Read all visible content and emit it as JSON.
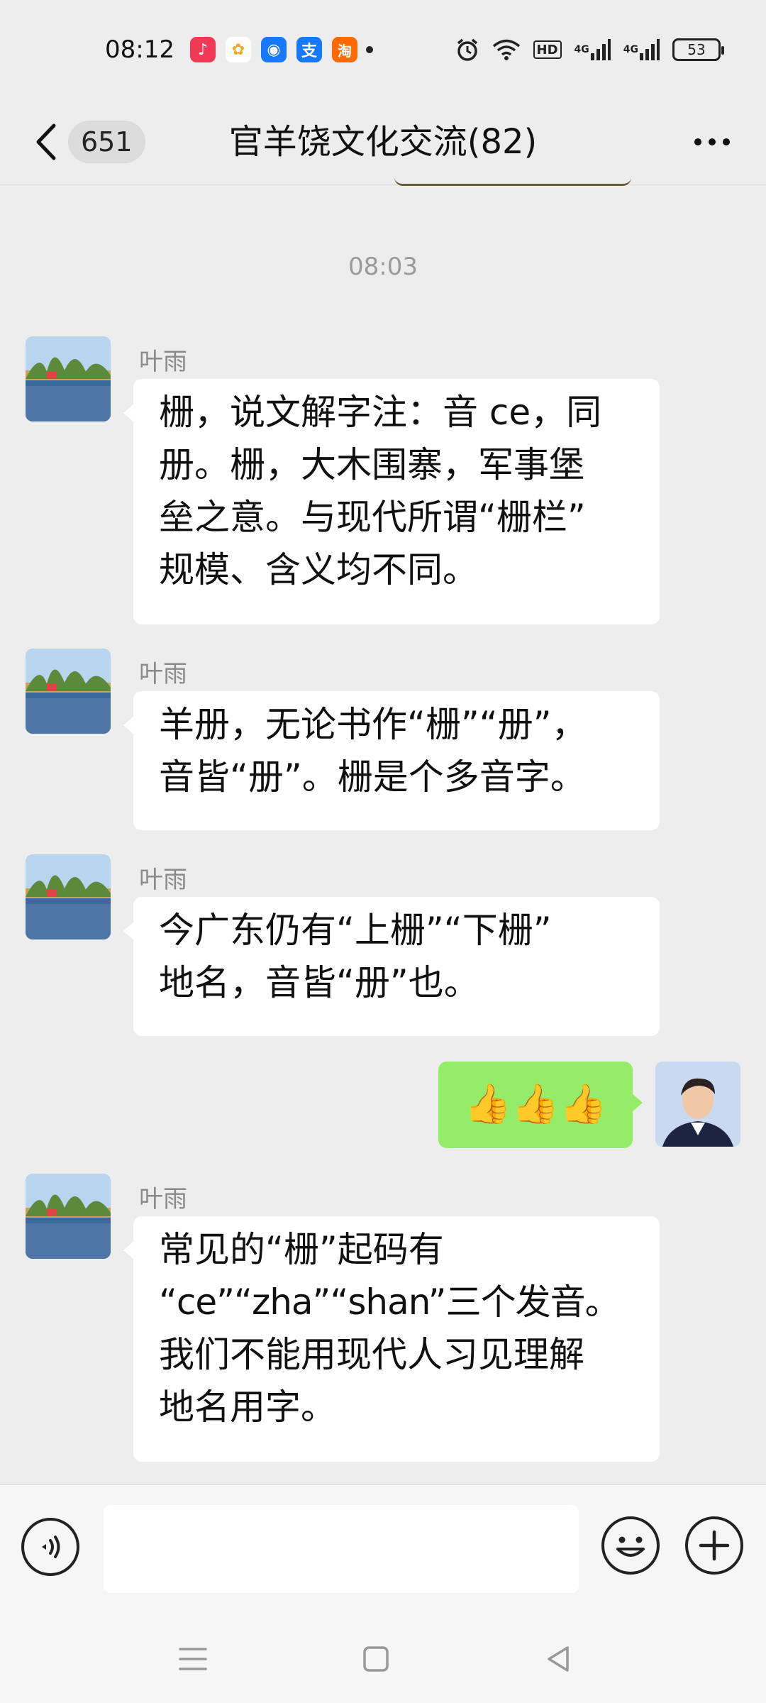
{
  "status_bar": {
    "time": "08:12",
    "app_icons": [
      {
        "name": "music-app-icon",
        "color": "#f03a55",
        "glyph": "♪"
      },
      {
        "name": "pinwheel-app-icon",
        "color": "#3bb3ff",
        "glyph": "✿"
      },
      {
        "name": "browser-app-icon",
        "color": "#1677ff",
        "glyph": "◉"
      },
      {
        "name": "alipay-app-icon",
        "color": "#1677ff",
        "glyph": "支"
      },
      {
        "name": "taobao-app-icon",
        "color": "#ff6a00",
        "glyph": "淘"
      }
    ],
    "signal_label_1": "4G",
    "signal_label_2": "4G",
    "hd_label": "HD",
    "battery": "53"
  },
  "header": {
    "unread_count": "651",
    "title": "官羊饶文化交流(82)"
  },
  "chat": {
    "time_separator": "08:03",
    "messages": [
      {
        "sender": "叶雨",
        "direction": "in",
        "lines": [
          "栅，说文解字注：音 ce，同",
          "册。栅，大木围寨，军事堡",
          "垒之意。与现代所谓“栅栏”",
          "规模、含义均不同。"
        ]
      },
      {
        "sender": "叶雨",
        "direction": "in",
        "lines": [
          "羊册，无论书作“栅”“册”，",
          "音皆“册”。栅是个多音字。"
        ]
      },
      {
        "sender": "叶雨",
        "direction": "in",
        "lines": [
          "今广东仍有“上栅”“下栅”",
          "地名，音皆“册”也。"
        ]
      },
      {
        "sender": "",
        "direction": "out",
        "text": "👍👍👍"
      },
      {
        "sender": "叶雨",
        "direction": "in",
        "lines": [
          "常见的“栅”起码有",
          "“ce”“zha”“shan”三个发音。",
          "我们不能用现代人习见理解",
          "地名用字。"
        ]
      }
    ]
  },
  "input_bar": {
    "placeholder": "",
    "value": ""
  },
  "colors": {
    "background": "#ededed",
    "incoming_bubble": "#ffffff",
    "outgoing_bubble": "#95ec69",
    "sender_name": "#8a8a8a"
  }
}
